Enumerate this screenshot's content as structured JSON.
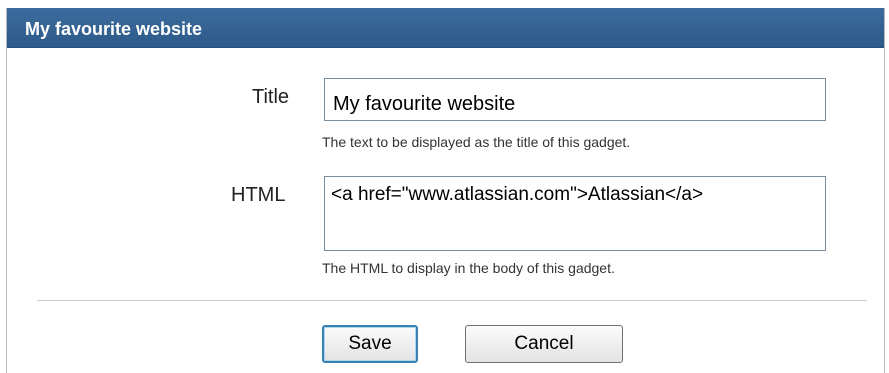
{
  "gadget": {
    "title": "My favourite website"
  },
  "form": {
    "title_field": {
      "label": "Title",
      "value": "My favourite website",
      "help": "The text to be displayed as the title of this gadget."
    },
    "html_field": {
      "label": "HTML",
      "value": "<a href=\"www.atlassian.com\">Atlassian</a>",
      "help": "The HTML to display in the body of this gadget."
    }
  },
  "buttons": {
    "save_label": "Save",
    "cancel_label": "Cancel"
  }
}
